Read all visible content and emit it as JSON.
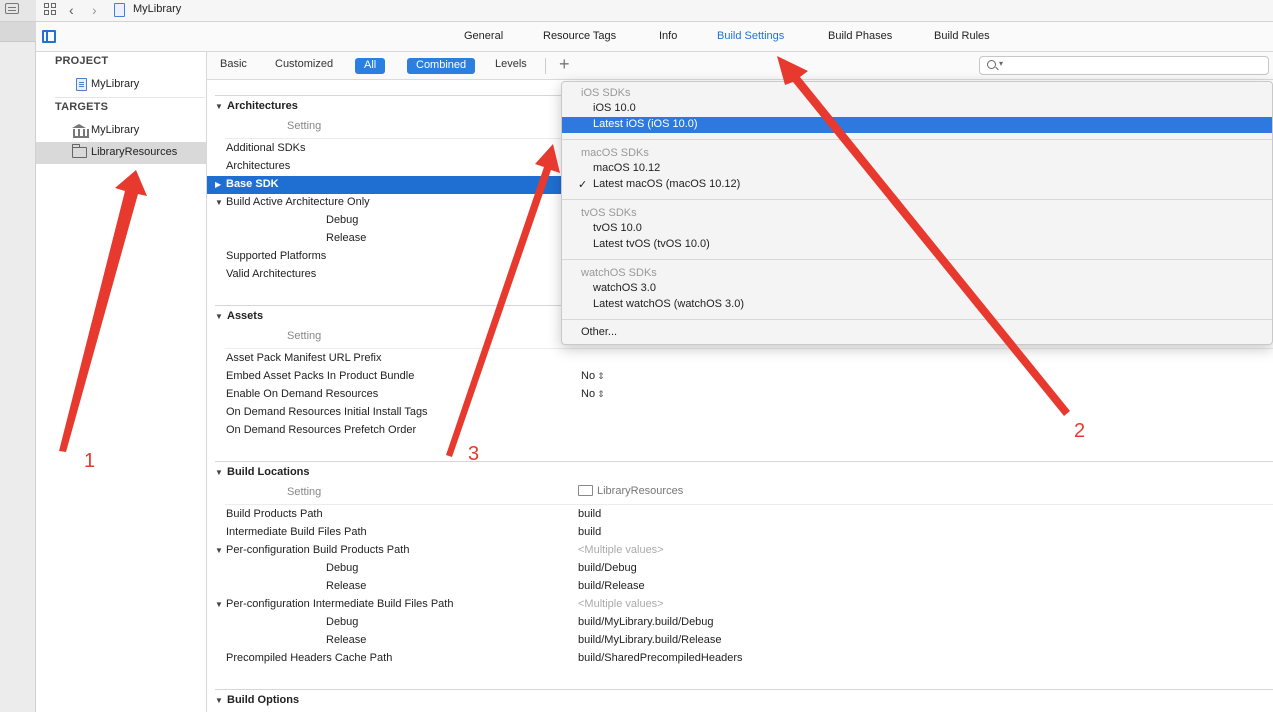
{
  "jumpbar": {
    "title": "MyLibrary",
    "icons": [
      "grid-icon",
      "chevron-left-icon",
      "chevron-right-icon",
      "project-file-icon"
    ]
  },
  "tabs": [
    "General",
    "Resource Tags",
    "Info",
    "Build Settings",
    "Build Phases",
    "Build Rules"
  ],
  "active_tab": "Build Settings",
  "sidebar": {
    "project_header": "PROJECT",
    "project_item": "MyLibrary",
    "targets_header": "TARGETS",
    "targets": [
      "MyLibrary",
      "LibraryResources"
    ],
    "selected_target": "LibraryResources"
  },
  "filterbar": {
    "basic": "Basic",
    "customized": "Customized",
    "all": "All",
    "combined": "Combined",
    "levels": "Levels",
    "plus": "+"
  },
  "architectures": {
    "title": "Architectures",
    "setting_header": "Setting",
    "rows": {
      "additional_sdks": "Additional SDKs",
      "architectures": "Architectures",
      "base_sdk": "Base SDK",
      "build_active_arch": "Build Active Architecture Only",
      "debug": "Debug",
      "release": "Release",
      "supported_platforms": "Supported Platforms",
      "valid_architectures": "Valid Architectures"
    }
  },
  "assets": {
    "title": "Assets",
    "setting_header": "Setting",
    "rows": {
      "manifest_url": "Asset Pack Manifest URL Prefix",
      "embed_packs": "Embed Asset Packs In Product Bundle",
      "embed_packs_val": "No",
      "enable_odr": "Enable On Demand Resources",
      "enable_odr_val": "No",
      "initial_tags": "On Demand Resources Initial Install Tags",
      "prefetch_order": "On Demand Resources Prefetch Order"
    }
  },
  "build_locations": {
    "title": "Build Locations",
    "setting_header": "Setting",
    "column_target": "LibraryResources",
    "rows": {
      "products_path": "Build Products Path",
      "products_path_val": "build",
      "intermediate_path": "Intermediate Build Files Path",
      "intermediate_path_val": "build",
      "per_config_products": "Per-configuration Build Products Path",
      "multiple": "<Multiple values>",
      "debug": "Debug",
      "debug_products_val": "build/Debug",
      "release": "Release",
      "release_products_val": "build/Release",
      "per_config_intermediate": "Per-configuration Intermediate Build Files Path",
      "debug_intermediate_val": "build/MyLibrary.build/Debug",
      "release_intermediate_val": "build/MyLibrary.build/Release",
      "precompiled": "Precompiled Headers Cache Path",
      "precompiled_val": "build/SharedPrecompiledHeaders"
    }
  },
  "build_options": {
    "title": "Build Options"
  },
  "popup": {
    "ios_header": "iOS SDKs",
    "ios_items": [
      "iOS 10.0",
      "Latest iOS (iOS 10.0)"
    ],
    "macos_header": "macOS SDKs",
    "macos_items": [
      "macOS 10.12",
      "Latest macOS (macOS 10.12)"
    ],
    "tvos_header": "tvOS SDKs",
    "tvos_items": [
      "tvOS 10.0",
      "Latest tvOS (tvOS 10.0)"
    ],
    "watchos_header": "watchOS SDKs",
    "watchos_items": [
      "watchOS 3.0",
      "Latest watchOS (watchOS 3.0)"
    ],
    "other": "Other...",
    "highlighted": "Latest iOS (iOS 10.0)",
    "checked": "Latest macOS (macOS 10.12)",
    "check_mark": "✓"
  },
  "annotations": {
    "label_1": "1",
    "label_2": "2",
    "label_3": "3",
    "color": "#e8392f"
  },
  "colors": {
    "accent": "#1f73d6",
    "selection": "#1f6fd2",
    "menu_highlight": "#2d79e0"
  }
}
